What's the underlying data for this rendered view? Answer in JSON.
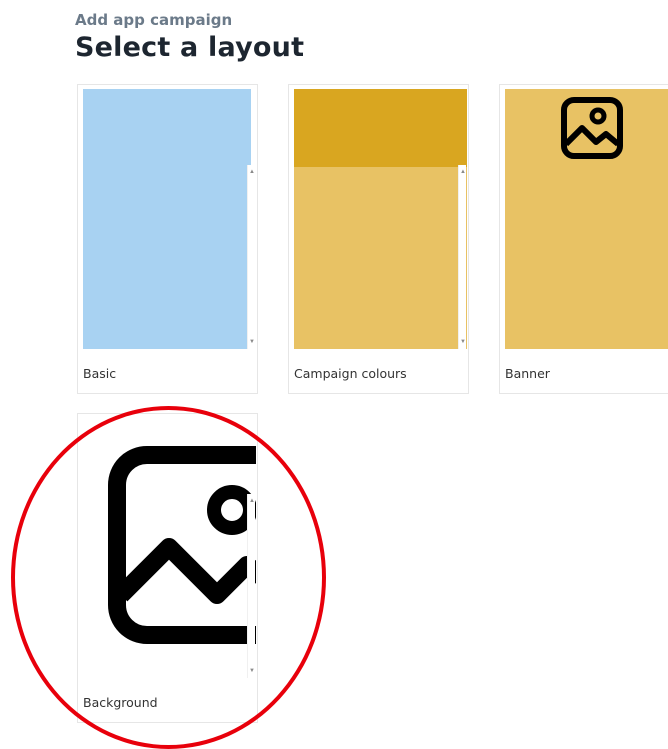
{
  "header": {
    "subtitle": "Add app campaign",
    "title": "Select a layout"
  },
  "layouts": [
    {
      "label": "Basic",
      "preview_color": "#a8d2f2"
    },
    {
      "label": "Campaign colours",
      "preview_color": "#e8c264",
      "header_color": "#d9a620"
    },
    {
      "label": "Banner",
      "preview_color": "#e8c264",
      "icon": "image-icon"
    },
    {
      "label": "Background",
      "preview_color": "#ffffff",
      "icon": "image-icon",
      "highlighted": true
    }
  ],
  "colors": {
    "highlight_circle": "#e8000b",
    "heading": "#1d2630",
    "subheading": "#6b7a89"
  }
}
